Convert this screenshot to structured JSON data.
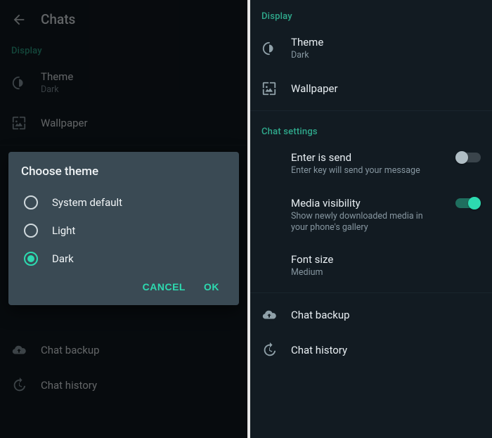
{
  "left": {
    "header_title": "Chats",
    "display_header": "Display",
    "theme_label": "Theme",
    "theme_value": "Dark",
    "wallpaper_label": "Wallpaper",
    "chat_backup_label": "Chat backup",
    "chat_history_label": "Chat history",
    "dialog": {
      "title": "Choose theme",
      "options": {
        "system": "System default",
        "light": "Light",
        "dark": "Dark"
      },
      "selected": "dark",
      "cancel": "CANCEL",
      "ok": "OK"
    }
  },
  "right": {
    "display_header": "Display",
    "theme_label": "Theme",
    "theme_value": "Dark",
    "wallpaper_label": "Wallpaper",
    "chat_settings_header": "Chat settings",
    "enter_send_label": "Enter is send",
    "enter_send_sub": "Enter key will send your message",
    "enter_send_on": false,
    "media_vis_label": "Media visibility",
    "media_vis_sub": "Show newly downloaded media in your phone's gallery",
    "media_vis_on": true,
    "font_size_label": "Font size",
    "font_size_value": "Medium",
    "chat_backup_label": "Chat backup",
    "chat_history_label": "Chat history"
  },
  "colors": {
    "accent": "#2ddab0",
    "bg": "#121b22",
    "dialog_bg": "#3a4a54"
  }
}
